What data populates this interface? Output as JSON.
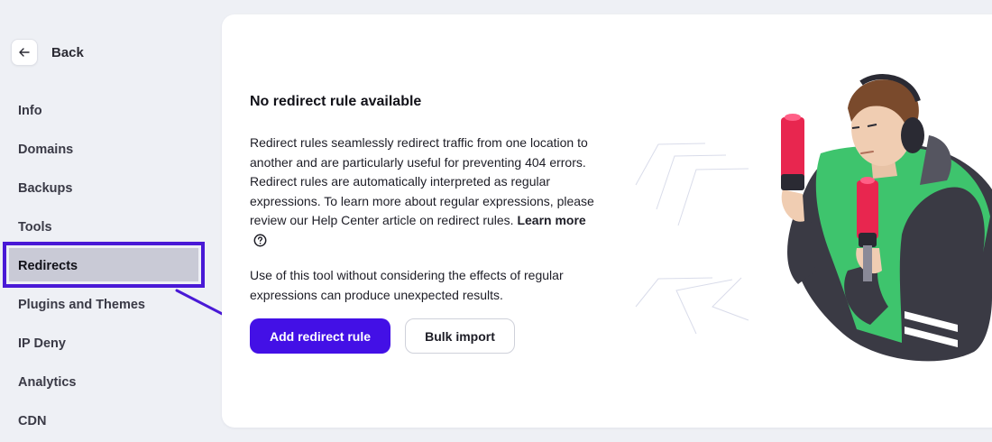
{
  "sidebar": {
    "back_label": "Back",
    "items": [
      {
        "label": "Info"
      },
      {
        "label": "Domains"
      },
      {
        "label": "Backups"
      },
      {
        "label": "Tools"
      },
      {
        "label": "Redirects"
      },
      {
        "label": "Plugins and Themes"
      },
      {
        "label": "IP Deny"
      },
      {
        "label": "Analytics"
      },
      {
        "label": "CDN"
      }
    ],
    "active_item": "Redirects"
  },
  "main": {
    "title": "No redirect rule available",
    "description": "Redirect rules seamlessly redirect traffic from one location to another and are particularly useful for preventing 404 errors. Redirect rules are automatically interpreted as regular expressions. To learn more about regular expressions, please review our Help Center article on redirect rules.",
    "learn_more_label": "Learn more",
    "warning": "Use of this tool without considering the effects of regular expressions can produce unexpected results.",
    "add_button_label": "Add redirect rule",
    "bulk_import_label": "Bulk import"
  },
  "icons": {
    "back": "arrow-left-icon",
    "help": "question-circle-icon",
    "annotation": "annotation-arrow"
  },
  "colors": {
    "accent": "#4310e6",
    "highlight_border": "#4919d6",
    "active_bg": "#c9cad6",
    "page_bg": "#eef0f5",
    "character_vest": "#3ec46d",
    "baton": "#e8264f"
  }
}
